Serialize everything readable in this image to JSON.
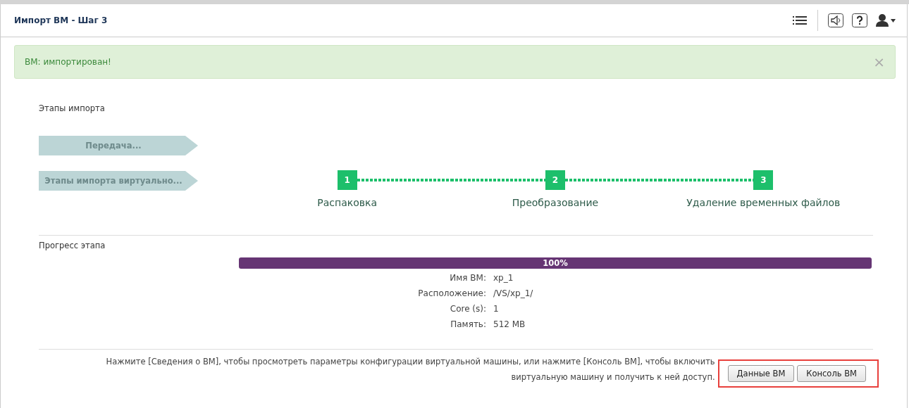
{
  "header": {
    "title": "Импорт ВМ - Шаг 3"
  },
  "alert": {
    "message": "ВМ: импортирован!",
    "close": "×"
  },
  "stages_title": "Этапы импорта",
  "stage_bars": [
    "Передача...",
    "Этапы импорта виртуально..."
  ],
  "steps": [
    {
      "number": "1",
      "label": "Распаковка"
    },
    {
      "number": "2",
      "label": "Преобразование"
    },
    {
      "number": "3",
      "label": "Удаление временных файлов"
    }
  ],
  "progress": {
    "title": "Прогресс этапа",
    "level": 1,
    "reading": "100%"
  },
  "details": [
    {
      "label": "Имя ВМ:",
      "value": "xp_1"
    },
    {
      "label": "Расположение:",
      "value": "/VS/xp_1/"
    },
    {
      "label": "Core (s):",
      "value": "1"
    },
    {
      "label": "Память:",
      "value": "512 MB"
    }
  ],
  "footer": {
    "hint": "Нажмите [Сведения о ВМ], чтобы просмотреть параметры конфигурации виртуальной машины, или нажмите [Консоль ВМ], чтобы включить виртуальную машину и получить к ней доступ.",
    "buttons": [
      "Данные ВМ",
      "Консоль ВМ"
    ]
  }
}
